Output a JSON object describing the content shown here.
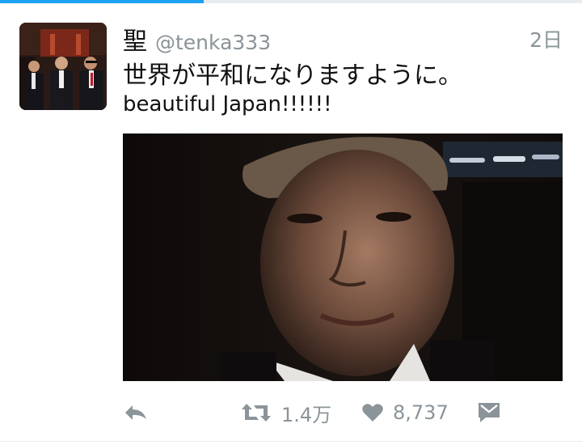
{
  "tweet": {
    "display_name": "聖",
    "handle": "@tenka333",
    "timestamp": "2日",
    "text_line1": "世界が平和になりますように。",
    "text_line2": "beautiful Japan!!!!!!",
    "retweet_count": "1.4万",
    "like_count": "8,737"
  },
  "loading_progress": 0.35,
  "colors": {
    "accent": "#1da1f2",
    "muted_text": "#8a9499",
    "primary_text": "#111111"
  },
  "icons": {
    "reply": "reply-icon",
    "retweet": "retweet-icon",
    "like": "heart-icon",
    "message": "direct-message-icon"
  }
}
